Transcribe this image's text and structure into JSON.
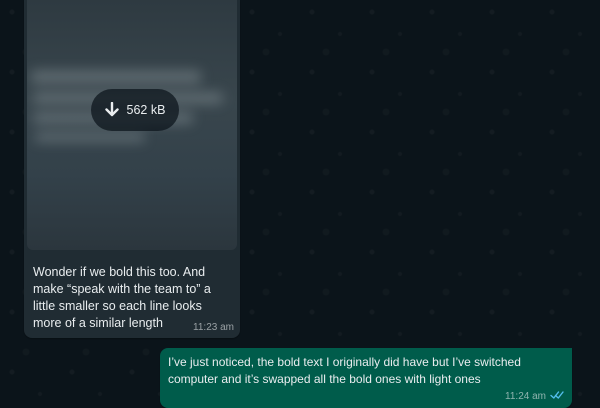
{
  "chat": {
    "incoming": {
      "media": {
        "file_size": "562 kB",
        "icon": "download-arrow-icon"
      },
      "caption": "Wonder if we bold this too. And make “speak with the team to” a little smaller so each line looks more of a similar length",
      "time": "11:23 am"
    },
    "outgoing": {
      "text": "I’ve just noticed, the bold text I originally did have but I’ve switched computer and it’s swapped all the bold ones with light ones",
      "time": "11:24 am",
      "status_icon": "double-check-icon"
    }
  },
  "colors": {
    "background": "#0b141a",
    "incoming_bubble": "#202c33",
    "outgoing_bubble": "#005c4b",
    "text": "#e9edef",
    "read_receipt": "#53bdeb"
  }
}
